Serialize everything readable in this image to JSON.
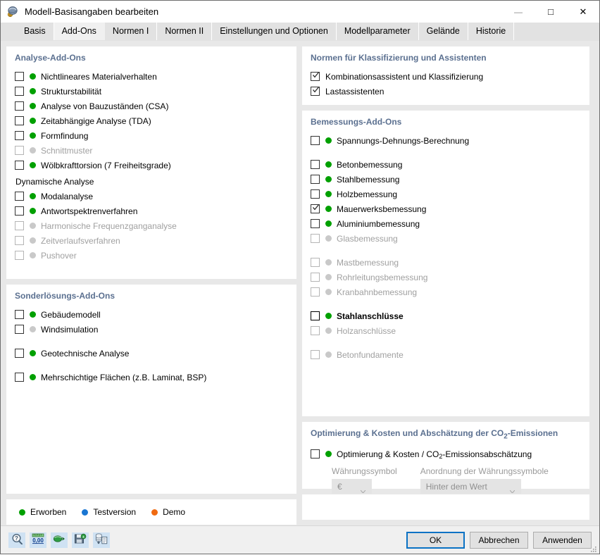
{
  "window": {
    "title": "Modell-Basisangaben bearbeiten",
    "icon": "model-settings-icon",
    "minimize_label": "—",
    "maximize_label": "□",
    "close_label": "✕"
  },
  "tabs": [
    {
      "label": "Basis",
      "active": false
    },
    {
      "label": "Add-Ons",
      "active": true
    },
    {
      "label": "Normen I",
      "active": false
    },
    {
      "label": "Normen II",
      "active": false
    },
    {
      "label": "Einstellungen und Optionen",
      "active": false
    },
    {
      "label": "Modellparameter",
      "active": false
    },
    {
      "label": "Gelände",
      "active": false
    },
    {
      "label": "Historie",
      "active": false
    }
  ],
  "left": {
    "analysis_panel": {
      "title": "Analyse-Add-Ons",
      "items": [
        {
          "label": "Nichtlineares Materialverhalten",
          "checked": false,
          "enabled": true,
          "status": "green"
        },
        {
          "label": "Strukturstabilität",
          "checked": false,
          "enabled": true,
          "status": "green"
        },
        {
          "label": "Analyse von Bauzuständen (CSA)",
          "checked": false,
          "enabled": true,
          "status": "green"
        },
        {
          "label": "Zeitabhängige Analyse (TDA)",
          "checked": false,
          "enabled": true,
          "status": "green"
        },
        {
          "label": "Formfindung",
          "checked": false,
          "enabled": true,
          "status": "green"
        },
        {
          "label": "Schnittmuster",
          "checked": false,
          "enabled": false,
          "status": "grey"
        },
        {
          "label": "Wölbkrafttorsion (7 Freiheitsgrade)",
          "checked": false,
          "enabled": true,
          "status": "green"
        }
      ],
      "dynamic_subtitle": "Dynamische Analyse",
      "dynamic_items": [
        {
          "label": "Modalanalyse",
          "checked": false,
          "enabled": true,
          "status": "green"
        },
        {
          "label": "Antwortspektrenverfahren",
          "checked": false,
          "enabled": true,
          "status": "green"
        },
        {
          "label": "Harmonische Frequenzganganalyse",
          "checked": false,
          "enabled": false,
          "status": "grey"
        },
        {
          "label": "Zeitverlaufsverfahren",
          "checked": false,
          "enabled": false,
          "status": "grey"
        },
        {
          "label": "Pushover",
          "checked": false,
          "enabled": false,
          "status": "grey"
        }
      ]
    },
    "special_panel": {
      "title": "Sonderlösungs-Add-Ons",
      "items": [
        {
          "label": "Gebäudemodell",
          "checked": false,
          "enabled": true,
          "status": "green",
          "gap": "none"
        },
        {
          "label": "Windsimulation",
          "checked": false,
          "enabled": true,
          "status": "grey",
          "gap": "none"
        },
        {
          "label": "Geotechnische Analyse",
          "checked": false,
          "enabled": true,
          "status": "green",
          "gap": "large"
        },
        {
          "label": "Mehrschichtige Flächen (z.B. Laminat, BSP)",
          "checked": false,
          "enabled": true,
          "status": "green",
          "gap": "large"
        }
      ]
    },
    "legend": [
      {
        "label": "Erworben",
        "color_name": "green"
      },
      {
        "label": "Testversion",
        "color_name": "blue"
      },
      {
        "label": "Demo",
        "color_name": "orange"
      }
    ]
  },
  "right": {
    "norms_panel": {
      "title": "Normen für Klassifizierung und Assistenten",
      "items": [
        {
          "label": "Kombinationsassistent und Klassifizierung",
          "checked": true,
          "enabled": true,
          "status": "none"
        },
        {
          "label": "Lastassistenten",
          "checked": true,
          "enabled": true,
          "status": "none"
        }
      ]
    },
    "design_panel": {
      "title": "Bemessungs-Add-Ons",
      "items": [
        {
          "label": "Spannungs-Dehnungs-Berechnung",
          "checked": false,
          "enabled": true,
          "status": "green",
          "gap": "none"
        },
        {
          "label": "Betonbemessung",
          "checked": false,
          "enabled": true,
          "status": "green",
          "gap": "large"
        },
        {
          "label": "Stahlbemessung",
          "checked": false,
          "enabled": true,
          "status": "green",
          "gap": "none"
        },
        {
          "label": "Holzbemessung",
          "checked": false,
          "enabled": true,
          "status": "green",
          "gap": "none"
        },
        {
          "label": "Mauerwerksbemessung",
          "checked": true,
          "enabled": true,
          "status": "green",
          "gap": "none"
        },
        {
          "label": "Aluminiumbemessung",
          "checked": false,
          "enabled": true,
          "status": "green",
          "gap": "none"
        },
        {
          "label": "Glasbemessung",
          "checked": false,
          "enabled": false,
          "status": "grey",
          "gap": "none"
        },
        {
          "label": "Mastbemessung",
          "checked": false,
          "enabled": false,
          "status": "grey",
          "gap": "large"
        },
        {
          "label": "Rohrleitungsbemessung",
          "checked": false,
          "enabled": false,
          "status": "grey",
          "gap": "none"
        },
        {
          "label": "Kranbahnbemessung",
          "checked": false,
          "enabled": false,
          "status": "grey",
          "gap": "none"
        },
        {
          "label": "Stahlanschlüsse",
          "checked": false,
          "enabled": true,
          "status": "green",
          "gap": "large",
          "focused": true
        },
        {
          "label": "Holzanschlüsse",
          "checked": false,
          "enabled": false,
          "status": "grey",
          "gap": "none"
        },
        {
          "label": "Betonfundamente",
          "checked": false,
          "enabled": false,
          "status": "grey",
          "gap": "large"
        }
      ]
    },
    "optimization_panel": {
      "title_parts": {
        "before": "Optimierung & Kosten und Abschätzung der CO",
        "sub": "2",
        "after": "-Emissionen"
      },
      "item": {
        "label_parts": {
          "before": "Optimierung & Kosten / CO",
          "sub": "2",
          "after": "-Emissionsabschätzung"
        },
        "checked": false,
        "enabled": true,
        "status": "green"
      },
      "currency_symbol_label": "Währungssymbol",
      "currency_symbol_value": "€",
      "currency_position_label": "Anordnung der Währungssymbole",
      "currency_position_value": "Hinter dem Wert"
    }
  },
  "footer": {
    "tool_buttons": [
      {
        "name": "help-search-icon"
      },
      {
        "name": "units-decimals-icon"
      },
      {
        "name": "import-settings-icon"
      },
      {
        "name": "save-settings-icon"
      },
      {
        "name": "database-copy-icon"
      }
    ],
    "buttons": [
      {
        "label": "OK",
        "primary": true
      },
      {
        "label": "Abbrechen",
        "primary": false
      },
      {
        "label": "Anwenden",
        "primary": false
      }
    ]
  },
  "colors": {
    "accent": "#0a72c4",
    "panel_title": "#5b7090",
    "acquired": "#00a000",
    "trial": "#1976d2",
    "demo": "#f06a11",
    "disabled": "#c9c9c9"
  }
}
